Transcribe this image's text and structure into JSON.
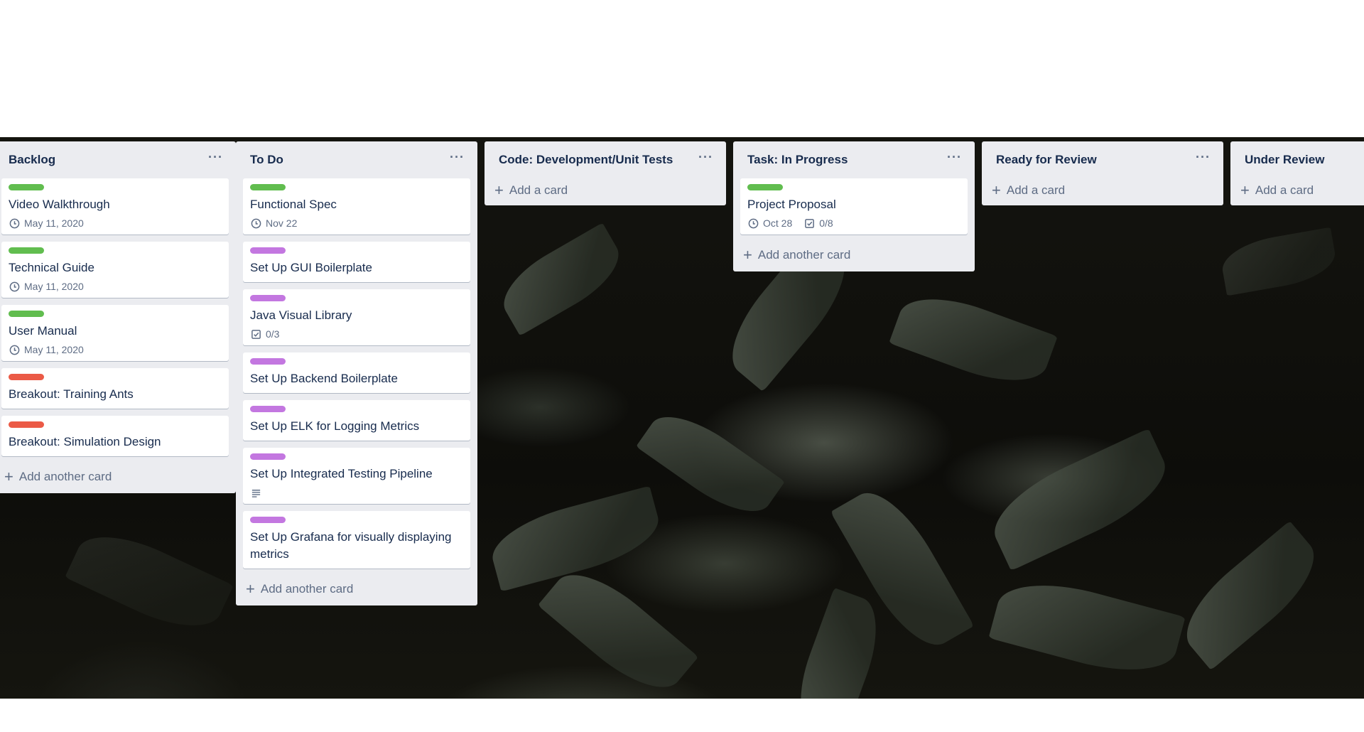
{
  "colors": {
    "green": "#61bd4f",
    "purple": "#c377e0",
    "red": "#eb5a46",
    "list_bg": "#ebecf0"
  },
  "lists": [
    {
      "title": "Backlog",
      "menu": "···",
      "cards": [
        {
          "label": "green",
          "title": "Video Walkthrough",
          "due": "May 11, 2020"
        },
        {
          "label": "green",
          "title": "Technical Guide",
          "due": "May 11, 2020"
        },
        {
          "label": "green",
          "title": "User Manual",
          "due": "May 11, 2020"
        },
        {
          "label": "red",
          "title": "Breakout: Training Ants"
        },
        {
          "label": "red",
          "title": "Breakout: Simulation Design"
        }
      ],
      "add_label": "Add another card"
    },
    {
      "title": "To Do",
      "menu": "···",
      "cards": [
        {
          "label": "green",
          "title": "Functional Spec",
          "due": "Nov 22"
        },
        {
          "label": "purple",
          "title": "Set Up GUI Boilerplate"
        },
        {
          "label": "purple",
          "title": "Java Visual Library",
          "checklist": "0/3"
        },
        {
          "label": "purple",
          "title": "Set Up Backend Boilerplate"
        },
        {
          "label": "purple",
          "title": "Set Up ELK for Logging Metrics"
        },
        {
          "label": "purple",
          "title": "Set Up Integrated Testing Pipeline",
          "description_icon": "description-icon"
        },
        {
          "label": "purple",
          "title": "Set Up Grafana for visually displaying metrics"
        }
      ],
      "add_label": "Add another card"
    },
    {
      "title": "Code: Development/Unit Tests",
      "menu": "···",
      "cards": [],
      "add_label": "Add a card"
    },
    {
      "title": "Task: In Progress",
      "menu": "···",
      "cards": [
        {
          "label": "green",
          "title": "Project Proposal",
          "due": "Oct 28",
          "checklist": "0/8"
        }
      ],
      "add_label": "Add another card"
    },
    {
      "title": "Ready for Review",
      "menu": "···",
      "cards": [],
      "add_label": "Add a card"
    },
    {
      "title": "Under Review",
      "menu": "···",
      "cards": [],
      "add_label": "Add a card"
    }
  ],
  "icons": {
    "due": "clock-icon",
    "checklist": "checklist-icon",
    "description": "description-icon",
    "add": "plus-icon",
    "menu": "more-icon"
  }
}
